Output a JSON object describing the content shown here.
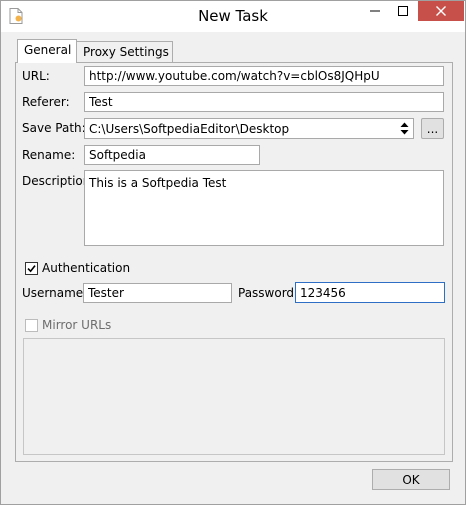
{
  "window": {
    "title": "New Task"
  },
  "tabs": [
    {
      "label": "General",
      "active": true
    },
    {
      "label": "Proxy Settings",
      "active": false
    }
  ],
  "form": {
    "url_label": "URL:",
    "url_value": "http://www.youtube.com/watch?v=cblOs8JQHpU",
    "referer_label": "Referer:",
    "referer_value": "Test",
    "save_path_label": "Save Path:",
    "save_path_value": "C:\\Users\\SoftpediaEditor\\Desktop",
    "browse_label": "...",
    "rename_label": "Rename:",
    "rename_value": "Softpedia",
    "description_label": "Description:",
    "description_value": "This is a Softpedia Test",
    "authentication_label": "Authentication",
    "authentication_checked": true,
    "username_label": "Username:",
    "username_value": "Tester",
    "password_label": "Password:",
    "password_value": "123456",
    "mirror_label": "Mirror URLs",
    "mirror_checked": false
  },
  "footer": {
    "ok_label": "OK"
  },
  "colors": {
    "close_button": "#c7504a",
    "focus_border": "#2f6ec5",
    "panel_background": "#f0f0f0"
  }
}
